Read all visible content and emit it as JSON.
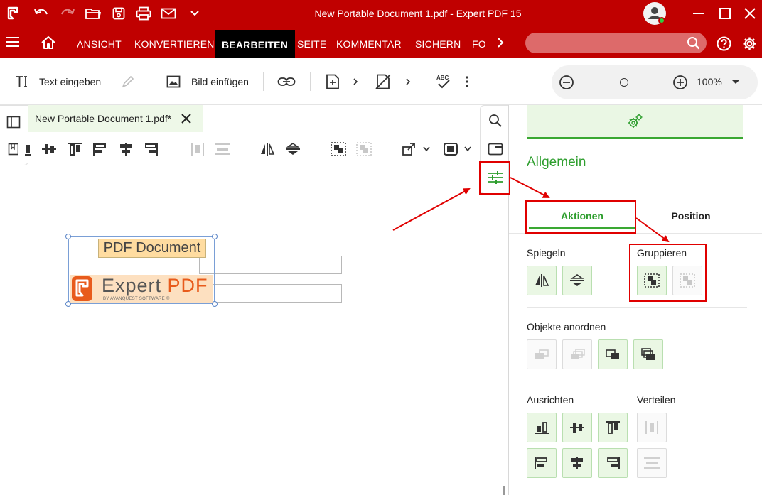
{
  "window": {
    "file_name": "New Portable Document 1.pdf",
    "separator": " - ",
    "app_name": "Expert PDF 15"
  },
  "menu": {
    "items": [
      "ANSICHT",
      "KONVERTIEREN",
      "BEARBEITEN",
      "SEITE",
      "KOMMENTAR",
      "SICHERN",
      "FO"
    ],
    "active": "BEARBEITEN"
  },
  "toolbar": {
    "text_label": "Text eingeben",
    "image_label": "Bild einfügen",
    "zoom_level": "100%",
    "zoom_slider_fraction": 0.5
  },
  "document_tab": {
    "label": "New Portable Document 1.pdf*"
  },
  "page": {
    "text_field": "PDF Document",
    "logo_name": "Expert ",
    "logo_pdf": "PDF",
    "logo_sub": "BY AVANQUEST SOFTWARE ©"
  },
  "panel": {
    "title": "Allgemein",
    "tabs": [
      "Aktionen",
      "Position"
    ],
    "active_tab": "Aktionen",
    "sections": {
      "mirror": "Spiegeln",
      "group": "Gruppieren",
      "arrange": "Objekte anordnen",
      "align": "Ausrichten",
      "distribute": "Verteilen"
    }
  },
  "colors": {
    "brand_red": "#c00000",
    "accent_green": "#3aa832",
    "annotation_red": "#e00000"
  }
}
